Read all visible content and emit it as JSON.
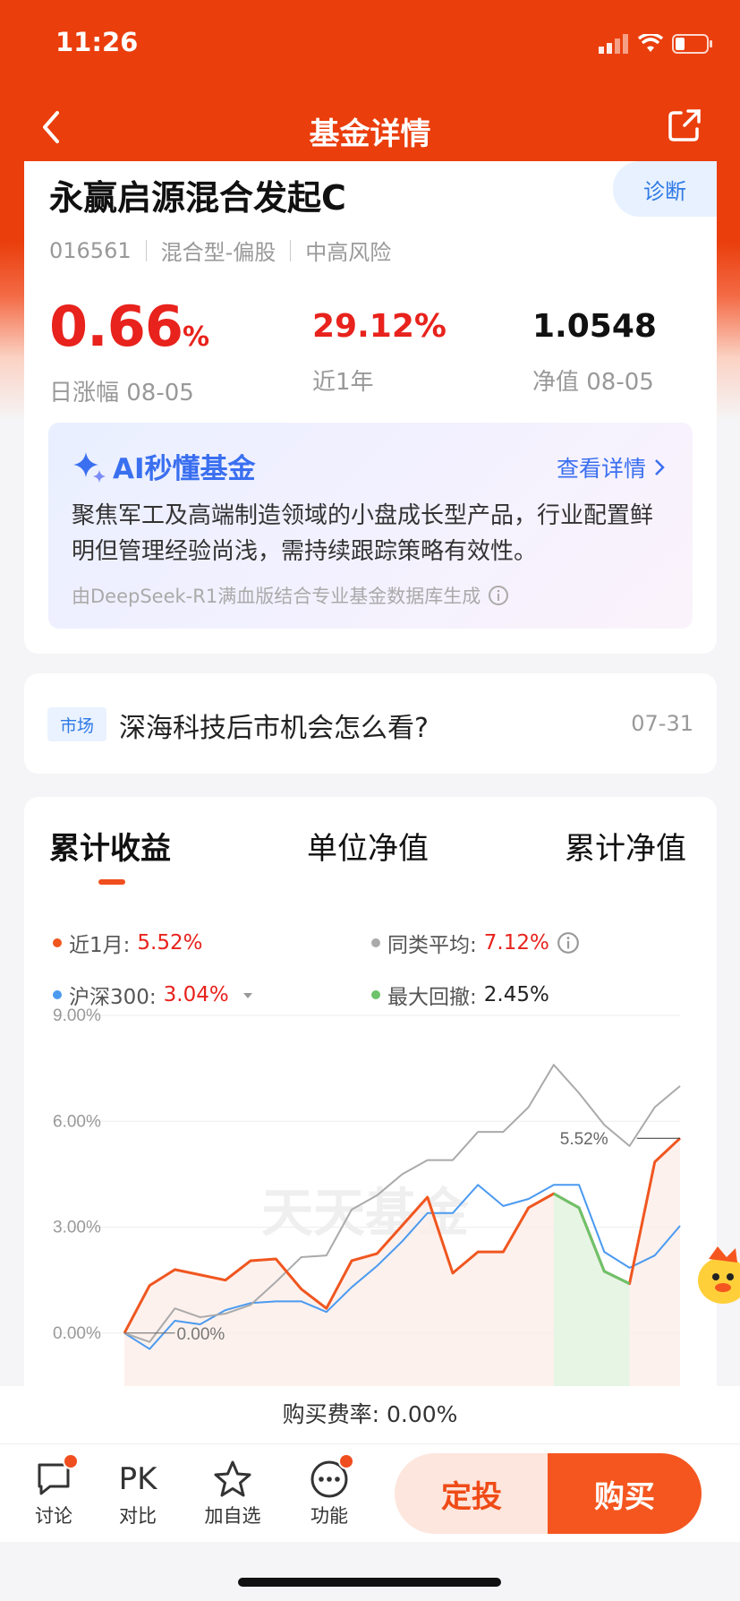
{
  "status": {
    "time": "11:26"
  },
  "nav": {
    "title": "基金详情"
  },
  "fund": {
    "name": "永赢启源混合发起C",
    "diagnose_label": "诊断",
    "code": "016561",
    "type": "混合型-偏股",
    "risk": "中高风险",
    "daily_change_value": "0.66",
    "daily_change_unit": "%",
    "daily_change_label": "日涨幅 08-05",
    "one_year_value": "29.12%",
    "one_year_label": "近1年",
    "nav_value": "1.0548",
    "nav_label": "净值 08-05"
  },
  "ai": {
    "title": "AI秒懂基金",
    "link": "查看详情",
    "text": "聚焦军工及高端制造领域的小盘成长型产品，行业配置鲜明但管理经验尚浅，需持续跟踪策略有效性。",
    "source": "由DeepSeek-R1满血版结合专业基金数据库生成"
  },
  "news": {
    "tag": "市场",
    "title": "深海科技后市机会怎么看?",
    "date": "07-31"
  },
  "tabs": [
    "累计收益",
    "单位净值",
    "累计净值"
  ],
  "legend": {
    "fund_label": "近1月:",
    "fund_value": "5.52%",
    "peer_label": "同类平均:",
    "peer_value": "7.12%",
    "index_label": "沪深300:",
    "index_value": "3.04%",
    "drawdown_label": "最大回撤:",
    "drawdown_value": "2.45%"
  },
  "colors": {
    "accent": "#ea3e0c",
    "fund_line": "#f0561f",
    "peer_line": "#aaaaaa",
    "index_line": "#4a9af0",
    "drawdown": "#6cc36a",
    "rise": "#e8221c",
    "link_blue": "#3a6ff0"
  },
  "chart_data": {
    "type": "line",
    "ylim": [
      -1.4,
      9.0
    ],
    "yticks": [
      "9.00%",
      "6.00%",
      "3.00%",
      "0.00%"
    ],
    "ytick_values": [
      9,
      6,
      3,
      0
    ],
    "series": [
      {
        "name": "近1月",
        "values": [
          0.0,
          1.35,
          1.8,
          1.65,
          1.5,
          2.05,
          2.1,
          1.25,
          0.7,
          2.05,
          2.25,
          3.05,
          3.85,
          1.7,
          2.3,
          2.3,
          3.55,
          3.95,
          3.55,
          1.75,
          1.4,
          4.85,
          5.52
        ]
      },
      {
        "name": "同类平均",
        "values": [
          0.0,
          -0.25,
          0.7,
          0.45,
          0.55,
          0.8,
          1.45,
          2.15,
          2.2,
          3.5,
          3.9,
          4.5,
          4.9,
          4.9,
          5.7,
          5.7,
          6.4,
          7.6,
          6.8,
          5.9,
          5.3,
          6.4,
          7.0
        ]
      },
      {
        "name": "沪深300",
        "values": [
          0.0,
          -0.45,
          0.35,
          0.25,
          0.65,
          0.85,
          0.9,
          0.9,
          0.6,
          1.3,
          1.9,
          2.6,
          3.4,
          3.4,
          4.2,
          3.6,
          3.8,
          4.2,
          4.2,
          2.3,
          1.85,
          2.2,
          3.04
        ]
      }
    ],
    "drawdown_range": [
      17,
      20
    ],
    "annotations": {
      "start": "0.00%",
      "end": "5.52%"
    },
    "grid": true
  },
  "watermark": "天天基金",
  "fee": {
    "text": "购买费率: 0.00%"
  },
  "bottom": {
    "discuss": "讨论",
    "pk_icon": "PK",
    "compare": "对比",
    "watch": "加自选",
    "more": "功能",
    "dingtou": "定投",
    "buy": "购买"
  }
}
